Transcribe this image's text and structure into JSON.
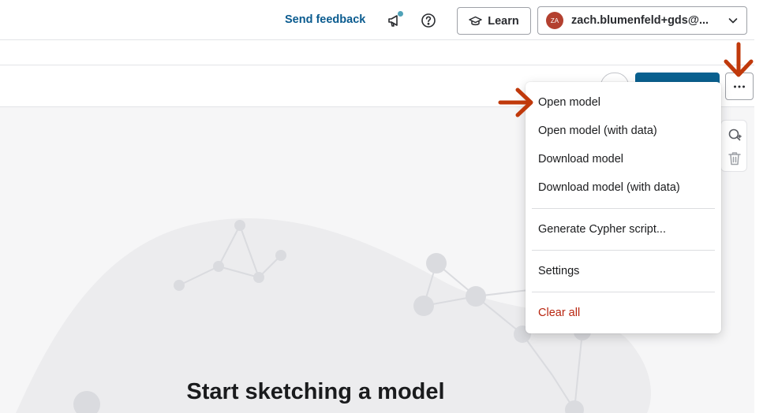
{
  "header": {
    "feedback_label": "Send feedback",
    "learn_label": "Learn",
    "user": {
      "initials": "ZA",
      "name": "zach.blumenfeld+gds@...",
      "avatar_color": "#b3402f"
    }
  },
  "canvas": {
    "title": "Start sketching a model"
  },
  "menu": {
    "items": [
      "Open model",
      "Open model (with data)",
      "Download model",
      "Download model (with data)",
      "Generate Cypher script...",
      "Settings",
      "Clear all"
    ]
  },
  "icons": {
    "announce": "megaphone-icon",
    "help": "help-circle-icon",
    "learn": "graduation-cap-icon",
    "dropdown": "chevron-down-icon",
    "more": "ellipsis-icon",
    "search_add": "search-plus-icon",
    "delete": "trash-icon",
    "annotation": "red-arrow-icon"
  },
  "colors": {
    "accent": "#0a5b8f",
    "primary_button": "#0a6190",
    "danger": "#b8250f",
    "annotation_arrow": "#c0390b"
  }
}
